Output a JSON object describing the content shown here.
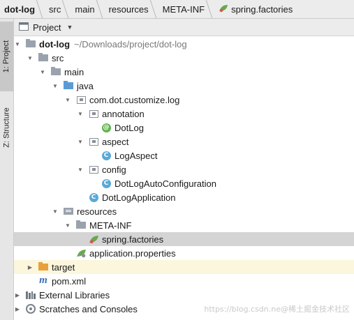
{
  "breadcrumb": {
    "items": [
      "dot-log",
      "src",
      "main",
      "resources",
      "META-INF",
      "spring.factories"
    ]
  },
  "toolstrip": {
    "project_tab": "1: Project",
    "structure_tab": "Z: Structure"
  },
  "panel": {
    "title": "Project",
    "icon": "project-view-icon"
  },
  "tree": {
    "root_label": "dot-log",
    "root_path": "~/Downloads/project/dot-log",
    "src": "src",
    "main": "main",
    "java": "java",
    "package": "com.dot.customize.log",
    "annotation_pkg": "annotation",
    "dotlog": "DotLog",
    "aspect_pkg": "aspect",
    "logaspect": "LogAspect",
    "config_pkg": "config",
    "autoconfig": "DotLogAutoConfiguration",
    "application": "DotLogApplication",
    "resources": "resources",
    "metainf": "META-INF",
    "spring_factories": "spring.factories",
    "app_properties": "application.properties",
    "target": "target",
    "pom": "pom.xml",
    "external_libs": "External Libraries",
    "scratches": "Scratches and Consoles"
  },
  "colors": {
    "selection": "#d4d4d4",
    "target_highlight": "#fbf6dc",
    "folder_blue": "#5b9bd5",
    "folder_orange": "#e8a13a",
    "class_icon": "#5aa9d6",
    "annotation_icon": "#5fb34a"
  },
  "watermark": "https://blog.csdn.ne@稀土掘金技术社区"
}
